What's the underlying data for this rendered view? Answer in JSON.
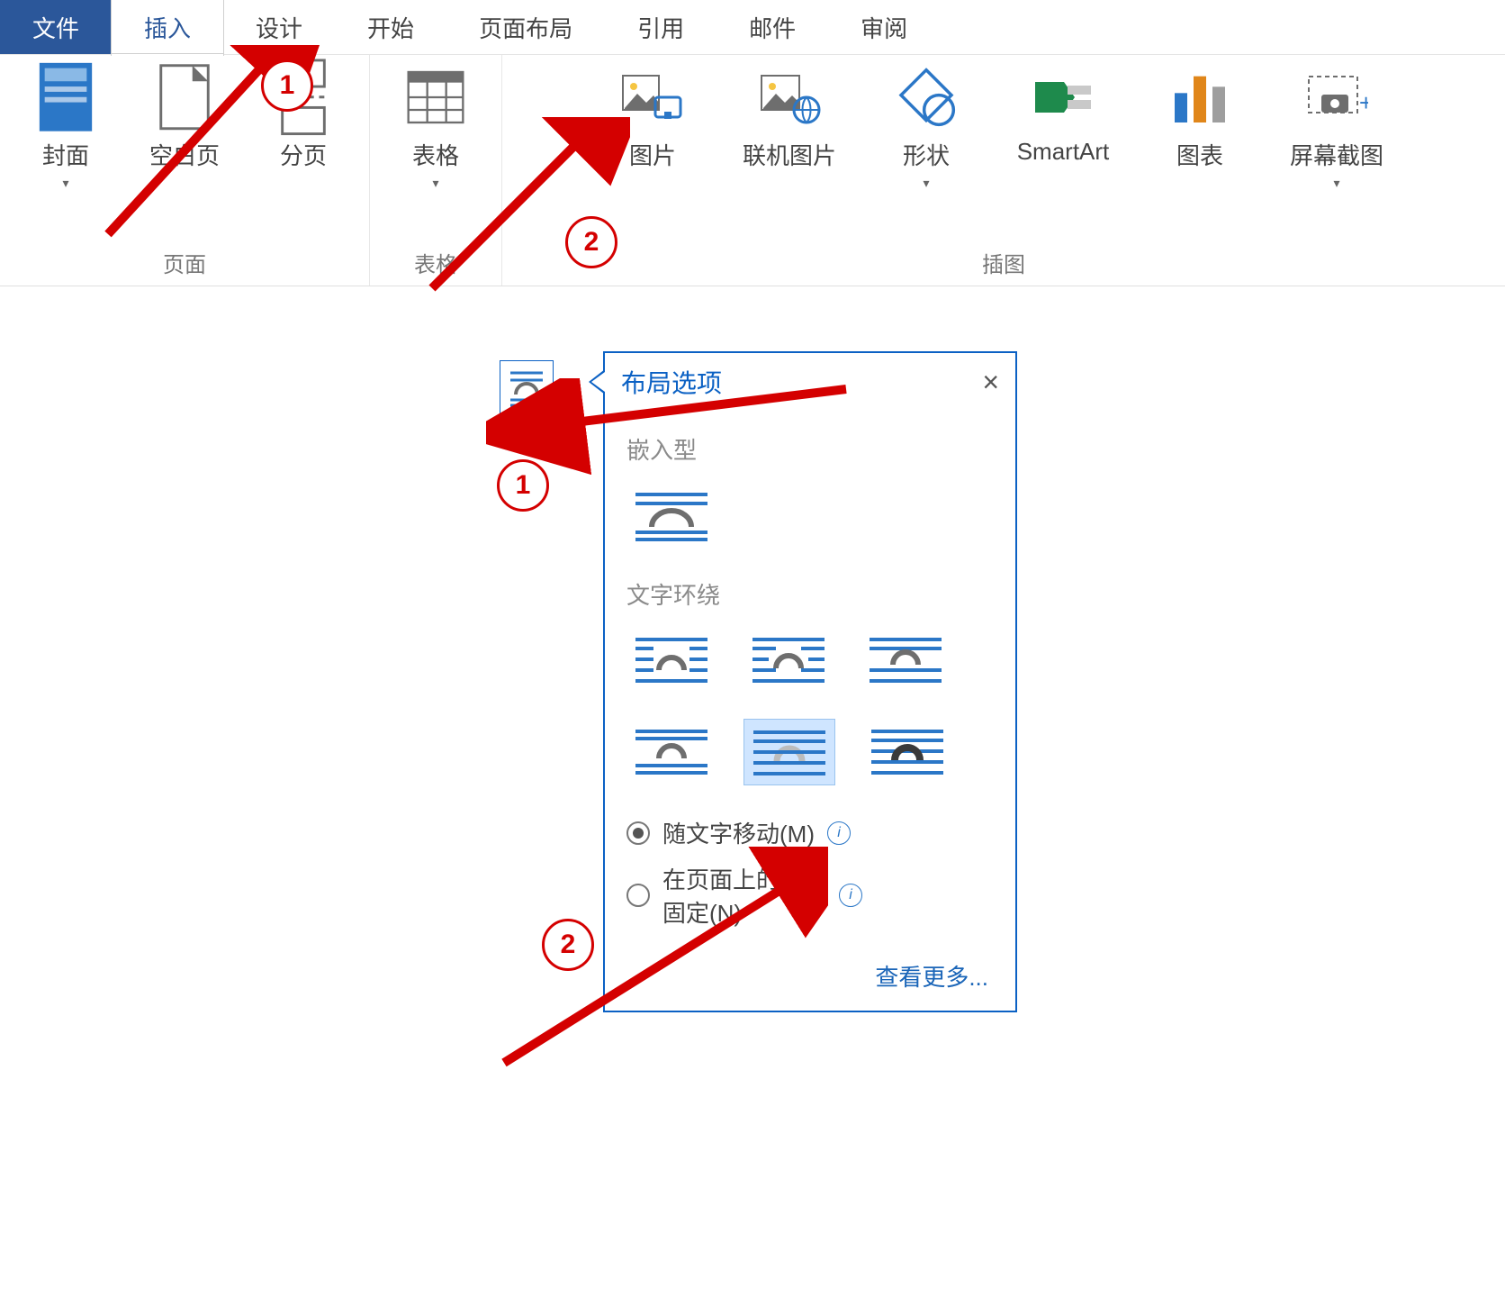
{
  "tabs": {
    "file": "文件",
    "insert": "插入",
    "design": "设计",
    "home": "开始",
    "layout": "页面布局",
    "references": "引用",
    "mailings": "邮件",
    "review": "审阅"
  },
  "ribbon": {
    "btn": {
      "cover": "封面",
      "blank": "空白页",
      "page_break": "分页",
      "table": "表格",
      "picture": "图片",
      "online_pic": "联机图片",
      "shapes": "形状",
      "smartart": "SmartArt",
      "chart": "图表",
      "screenshot": "屏幕截图"
    },
    "group": {
      "pages": "页面",
      "tables": "表格",
      "illustrations": "插图"
    }
  },
  "layout_options": {
    "title": "布局选项",
    "section_inline": "嵌入型",
    "section_wrap": "文字环绕",
    "radio_move": "随文字移动(M)",
    "radio_fixed_1": "在页面上的位置",
    "radio_fixed_2": "固定(N)",
    "see_more": "查看更多..."
  },
  "annotations": {
    "one": "1",
    "two": "2"
  }
}
